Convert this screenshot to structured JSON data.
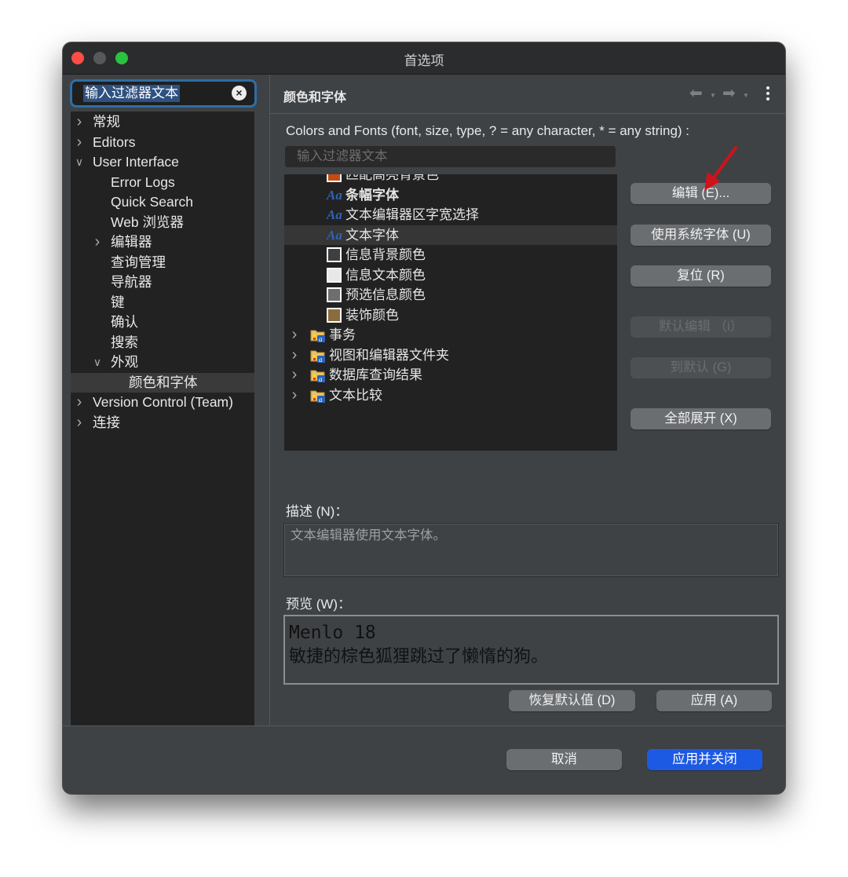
{
  "window": {
    "title": "首选项",
    "traffic_lights": {
      "close": "#fe4c47",
      "minimize": "#56585b",
      "maximize": "#2bc23f"
    }
  },
  "sidebar": {
    "filter_value": "输入过滤器文本",
    "clear_icon": "×",
    "items": [
      {
        "label": "常规",
        "expandable": true,
        "expanded": false,
        "level": 0
      },
      {
        "label": "Editors",
        "expandable": true,
        "expanded": false,
        "level": 0
      },
      {
        "label": "User Interface",
        "expandable": true,
        "expanded": true,
        "level": 0
      },
      {
        "label": "Error Logs",
        "expandable": false,
        "level": 1
      },
      {
        "label": "Quick Search",
        "expandable": false,
        "level": 1
      },
      {
        "label": "Web 浏览器",
        "expandable": false,
        "level": 1
      },
      {
        "label": "编辑器",
        "expandable": true,
        "expanded": false,
        "level": 1
      },
      {
        "label": "查询管理",
        "expandable": false,
        "level": 1
      },
      {
        "label": "导航器",
        "expandable": false,
        "level": 1
      },
      {
        "label": "键",
        "expandable": false,
        "level": 1
      },
      {
        "label": "确认",
        "expandable": false,
        "level": 1
      },
      {
        "label": "搜索",
        "expandable": false,
        "level": 1
      },
      {
        "label": "外观",
        "expandable": true,
        "expanded": true,
        "level": 1
      },
      {
        "label": "颜色和字体",
        "expandable": false,
        "level": 2,
        "selected": true
      },
      {
        "label": "Version Control (Team)",
        "expandable": true,
        "expanded": false,
        "level": 0
      },
      {
        "label": "连接",
        "expandable": true,
        "expanded": false,
        "level": 0
      }
    ]
  },
  "main": {
    "page_title": "颜色和字体",
    "nav": {
      "back_icon": "arrow-left",
      "forward_icon": "arrow-right",
      "menu_icon": "kebab-menu"
    },
    "list_label": "Colors and Fonts (font, size, type, ? = any character, * = any string) :",
    "filter_placeholder": "输入过滤器文本",
    "tree": [
      {
        "label": "匹配高亮背景色",
        "kind": "color",
        "color": "#c94a10",
        "bold": false
      },
      {
        "label": "条幅字体",
        "kind": "font",
        "bold": true
      },
      {
        "label": "文本编辑器区字宽选择",
        "kind": "font",
        "bold": false
      },
      {
        "label": "文本字体",
        "kind": "font",
        "bold": false,
        "selected": true
      },
      {
        "label": "信息背景颜色",
        "kind": "color",
        "color": "#3c4043"
      },
      {
        "label": "信息文本颜色",
        "kind": "color",
        "color": "#e8e8e8"
      },
      {
        "label": "预选信息颜色",
        "kind": "color",
        "color": "#6e6e6e"
      },
      {
        "label": "装饰颜色",
        "kind": "color",
        "color": "#8a6d3b"
      },
      {
        "label": "事务",
        "kind": "category"
      },
      {
        "label": "视图和编辑器文件夹",
        "kind": "category"
      },
      {
        "label": "数据库查询结果",
        "kind": "category"
      },
      {
        "label": "文本比较",
        "kind": "category"
      }
    ],
    "font_icon_glyph": "Aa",
    "buttons": {
      "edit": "编辑 (E)...",
      "use_system_font": "使用系统字体 (U)",
      "reset": "复位 (R)",
      "edit_default": "默认编辑 （i）",
      "go_to_default": "到默认 (G)",
      "expand_all": "全部展开 (X)"
    },
    "description_label": "描述 (N)：",
    "description_text": "文本编辑器使用文本字体。",
    "preview_label": "预览 (W)：",
    "preview_font": "Menlo 18",
    "preview_sample": "敏捷的棕色狐狸跳过了懒惰的狗。",
    "restore_defaults": "恢复默认值 (D)",
    "apply": "应用 (A)"
  },
  "footer": {
    "cancel": "取消",
    "apply_and_close": "应用并关闭",
    "primary_color": "#1d5ae3"
  },
  "annotation": {
    "arrow_color": "#d0121b",
    "points_to": "编辑 (E)..."
  }
}
